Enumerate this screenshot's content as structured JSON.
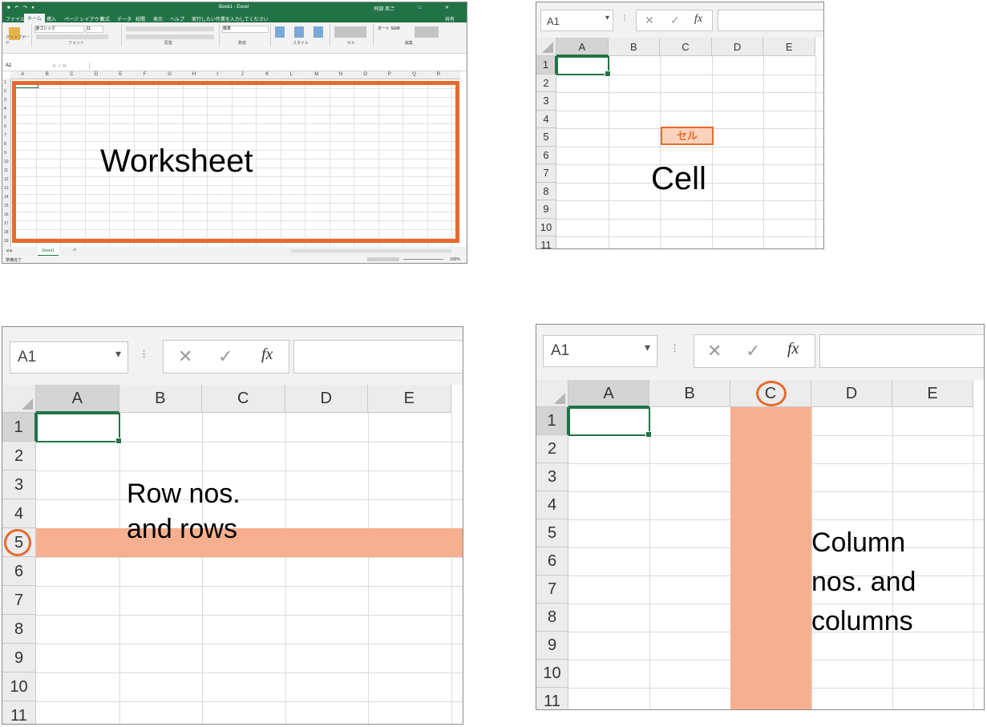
{
  "panel_worksheet": {
    "window_title": "Book1 - Excel",
    "user": "阿部 英二",
    "tabs": [
      "ファイル",
      "ホーム",
      "挿入",
      "ページ レイアウト",
      "数式",
      "データ",
      "校閲",
      "表示",
      "ヘルプ",
      "実行したい作業を入力してください",
      "共有"
    ],
    "ribbon_groups": [
      "クリップボード",
      "フォント",
      "配置",
      "数値",
      "スタイル",
      "セル",
      "編集"
    ],
    "font_name": "游ゴシック",
    "font_size": "11",
    "number_format": "標準",
    "autosum": "オート SUM",
    "name_box": "A1",
    "columns": [
      "A",
      "B",
      "C",
      "D",
      "E",
      "F",
      "G",
      "H",
      "I",
      "J",
      "K",
      "L",
      "M",
      "N",
      "O",
      "P",
      "Q",
      "R"
    ],
    "rows": [
      "1",
      "2",
      "3",
      "4",
      "5",
      "6",
      "7",
      "8",
      "9",
      "10",
      "11",
      "12",
      "13",
      "14",
      "15",
      "16",
      "17",
      "18",
      "19"
    ],
    "sheet_tab": "Sheet1",
    "status_left": "準備完了",
    "zoom": "100%",
    "label": "Worksheet",
    "highlight_color": "#e66a2c"
  },
  "panel_cell": {
    "name_box": "A1",
    "fx": "fx",
    "columns": [
      "A",
      "B",
      "C",
      "D",
      "E"
    ],
    "rows": [
      "1",
      "2",
      "3",
      "4",
      "5",
      "6",
      "7",
      "8",
      "9",
      "10",
      "11"
    ],
    "cell_tag": "セル",
    "label": "Cell"
  },
  "panel_rows": {
    "name_box": "A1",
    "fx": "fx",
    "columns": [
      "A",
      "B",
      "C",
      "D",
      "E"
    ],
    "rows": [
      "1",
      "2",
      "3",
      "4",
      "5",
      "6",
      "7",
      "8",
      "9",
      "10",
      "11"
    ],
    "highlight_row": "5",
    "label_line1": "Row nos.",
    "label_line2": "and rows",
    "band_color": "#f6b08f"
  },
  "panel_columns": {
    "name_box": "A1",
    "fx": "fx",
    "columns": [
      "A",
      "B",
      "C",
      "D",
      "E"
    ],
    "rows": [
      "1",
      "2",
      "3",
      "4",
      "5",
      "6",
      "7",
      "8",
      "9",
      "10",
      "11"
    ],
    "highlight_column": "C",
    "label_line1": "Column",
    "label_line2": "nos. and",
    "label_line3": "columns",
    "band_color": "#f6b08f"
  },
  "icons": [
    "dropdown-arrow-icon",
    "cancel-x-icon",
    "check-icon",
    "fx-icon",
    "select-all-icon"
  ],
  "accent_green": "#217346"
}
